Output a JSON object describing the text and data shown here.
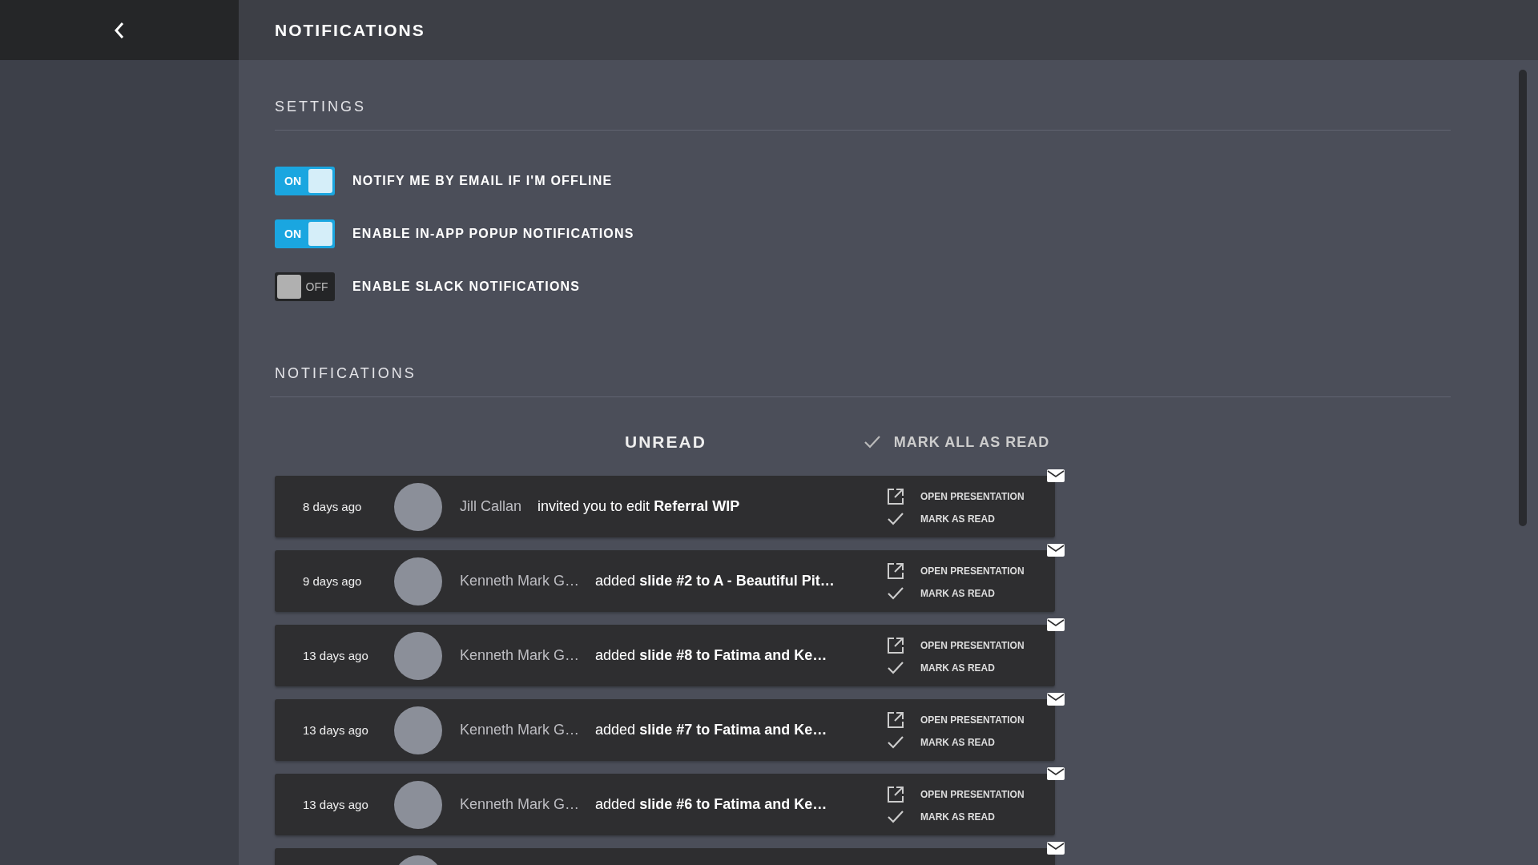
{
  "header": {
    "title": "NOTIFICATIONS"
  },
  "settings": {
    "heading": "SETTINGS",
    "toggles": [
      {
        "label": "NOTIFY ME BY EMAIL IF I'M OFFLINE",
        "on": true,
        "state_text": "ON"
      },
      {
        "label": "ENABLE IN-APP POPUP NOTIFICATIONS",
        "on": true,
        "state_text": "ON"
      },
      {
        "label": "ENABLE SLACK NOTIFICATIONS",
        "on": false,
        "state_text": "OFF"
      }
    ]
  },
  "notifications": {
    "heading": "NOTIFICATIONS",
    "list_title": "UNREAD",
    "mark_all": "MARK ALL AS READ",
    "items": [
      {
        "time": "8 days ago",
        "name": "Jill Callan",
        "message": "invited you to edit **Referral WIP**",
        "open": "OPEN PRESENTATION",
        "mark": "MARK AS READ",
        "unread": true
      },
      {
        "time": "9 days ago",
        "name": "Kenneth Mark G…",
        "message": "added **slide #2 to A - Beautiful Pit…**",
        "open": "OPEN PRESENTATION",
        "mark": "MARK AS READ",
        "unread": true
      },
      {
        "time": "13 days ago",
        "name": "Kenneth Mark G…",
        "message": "added **slide #8 to Fatima and Ke…**",
        "open": "OPEN PRESENTATION",
        "mark": "MARK AS READ",
        "unread": true
      },
      {
        "time": "13 days ago",
        "name": "Kenneth Mark G…",
        "message": "added **slide #7 to Fatima and Ke…**",
        "open": "OPEN PRESENTATION",
        "mark": "MARK AS READ",
        "unread": true
      },
      {
        "time": "13 days ago",
        "name": "Kenneth Mark G…",
        "message": "added **slide #6 to Fatima and Ke…**",
        "open": "OPEN PRESENTATION",
        "mark": "MARK AS READ",
        "unread": true
      }
    ]
  }
}
